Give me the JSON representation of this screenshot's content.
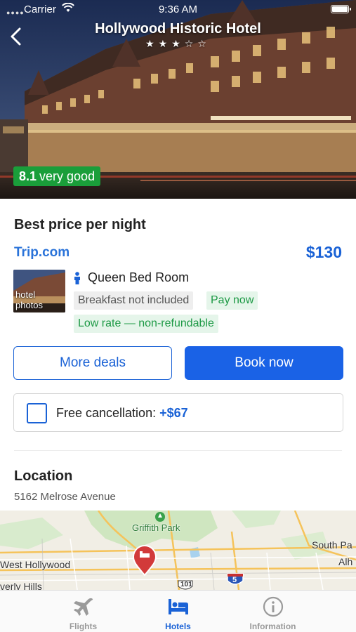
{
  "status_bar": {
    "carrier": "Carrier",
    "time": "9:36 AM"
  },
  "hotel": {
    "name": "Hollywood Historic Hotel",
    "stars_filled": 3,
    "stars_total": 5,
    "stars_text": "★★★☆☆",
    "rating_score": "8.1",
    "rating_text": "very good"
  },
  "price_section": {
    "title": "Best price per night",
    "provider": "Trip.com",
    "price": "$130",
    "thumb_text_line1": "hotel",
    "thumb_text_line2": "photos",
    "room_name": "Queen Bed Room",
    "tags": {
      "breakfast": "Breakfast not included",
      "pay": "Pay now",
      "rate": "Low rate — non-refundable"
    },
    "more_deals_label": "More deals",
    "book_now_label": "Book now",
    "free_cancellation_label": "Free cancellation:",
    "free_cancellation_price": "+$67",
    "free_cancellation_checked": false
  },
  "location": {
    "title": "Location",
    "address": "5162 Melrose Avenue",
    "map_labels": {
      "park": "Griffith Park",
      "west_hollywood": "West Hollywood",
      "beverly_hills": "verly Hills",
      "south_pasadena": "South Pa",
      "alhambra": "Alh",
      "route_101": "101",
      "route_5": "5"
    }
  },
  "tabs": [
    {
      "label": "Flights",
      "icon": "airplane-icon",
      "active": false
    },
    {
      "label": "Hotels",
      "icon": "bed-icon",
      "active": true
    },
    {
      "label": "Information",
      "icon": "info-icon",
      "active": false
    }
  ],
  "colors": {
    "accent": "#1a62d6",
    "rating_green": "#1a9e3a",
    "tag_green_text": "#1e9a46",
    "tag_green_bg": "#e5f5ea",
    "pin_red": "#d23a3a"
  }
}
